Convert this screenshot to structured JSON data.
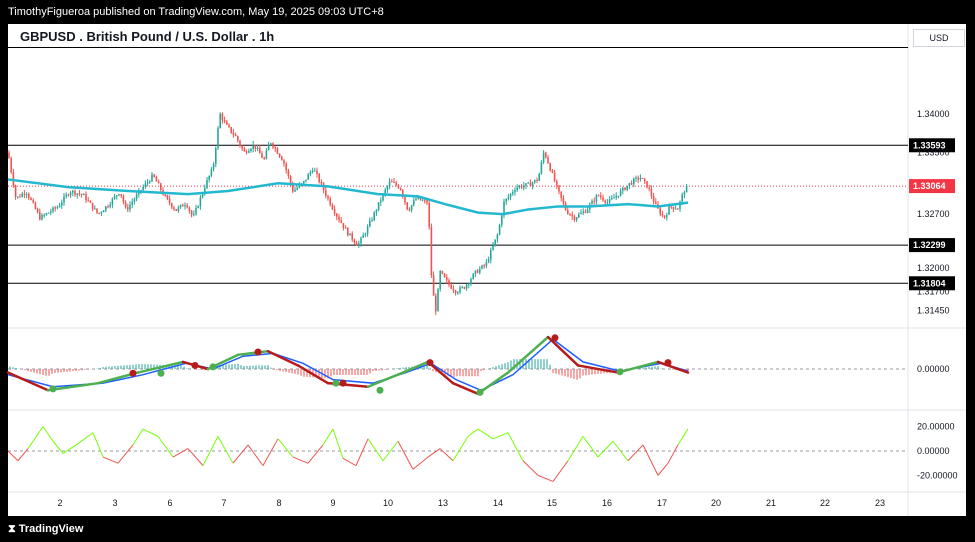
{
  "header": {
    "published_by": "TimothyFigueroa published on TradingView.com, May 19, 2025 09:03 UTC+8",
    "currency": "USD",
    "brand": "TradingView"
  },
  "colors": {
    "up": "#26a69a",
    "down": "#ef5350",
    "ema": "#22b8cf",
    "macd_fast": "#1e5eff",
    "macd_slow_up": "#4caf50",
    "macd_slow_down": "#b71c1c",
    "cci_up": "#76ff03",
    "cci_down": "#ef5350",
    "price_tag": "#f23645"
  },
  "chart_data": [
    {
      "type": "candlestick",
      "title": "GBPUSD . British Pound / U.S. Dollar . 1h",
      "ylim": [
        1.3125,
        1.3488
      ],
      "y_ticks": [
        1.3145,
        1.317,
        1.32,
        1.327,
        1.335,
        1.34
      ],
      "y_tick_labels": [
        "1.31450",
        "1.31700",
        "1.32000",
        "1.32700",
        "1.33500",
        "1.34000"
      ],
      "x_ticks": [
        "2",
        "3",
        "6",
        "7",
        "8",
        "9",
        "10",
        "13",
        "14",
        "15",
        "16",
        "17",
        "20",
        "21",
        "22",
        "23"
      ],
      "horizontal_levels": [
        {
          "value": 1.3486,
          "label": ""
        },
        {
          "value": 1.33593,
          "label": "1.33593"
        },
        {
          "value": 1.32299,
          "label": "1.32299"
        },
        {
          "value": 1.31804,
          "label": "1.31804"
        }
      ],
      "current_price": {
        "value": 1.33064,
        "label": "1.33064"
      },
      "price_path": [
        [
          0,
          1.335
        ],
        [
          8,
          1.329
        ],
        [
          18,
          1.33
        ],
        [
          32,
          1.3265
        ],
        [
          50,
          1.328
        ],
        [
          62,
          1.33
        ],
        [
          75,
          1.3295
        ],
        [
          90,
          1.327
        ],
        [
          100,
          1.3282
        ],
        [
          112,
          1.33
        ],
        [
          118,
          1.3275
        ],
        [
          132,
          1.33
        ],
        [
          145,
          1.332
        ],
        [
          158,
          1.329
        ],
        [
          168,
          1.3275
        ],
        [
          178,
          1.3285
        ],
        [
          185,
          1.3265
        ],
        [
          198,
          1.331
        ],
        [
          205,
          1.333
        ],
        [
          212,
          1.34
        ],
        [
          218,
          1.3385
        ],
        [
          228,
          1.337
        ],
        [
          236,
          1.335
        ],
        [
          246,
          1.336
        ],
        [
          256,
          1.334
        ],
        [
          262,
          1.3365
        ],
        [
          275,
          1.334
        ],
        [
          285,
          1.33
        ],
        [
          295,
          1.331
        ],
        [
          305,
          1.333
        ],
        [
          318,
          1.3295
        ],
        [
          328,
          1.327
        ],
        [
          340,
          1.3245
        ],
        [
          350,
          1.323
        ],
        [
          358,
          1.3248
        ],
        [
          366,
          1.327
        ],
        [
          375,
          1.3295
        ],
        [
          382,
          1.3312
        ],
        [
          392,
          1.3305
        ],
        [
          400,
          1.3275
        ],
        [
          408,
          1.329
        ],
        [
          420,
          1.3285
        ],
        [
          424,
          1.3175
        ],
        [
          428,
          1.3145
        ],
        [
          432,
          1.3195
        ],
        [
          440,
          1.318
        ],
        [
          448,
          1.317
        ],
        [
          456,
          1.3175
        ],
        [
          468,
          1.3195
        ],
        [
          478,
          1.3205
        ],
        [
          490,
          1.3245
        ],
        [
          496,
          1.3285
        ],
        [
          508,
          1.3305
        ],
        [
          520,
          1.3308
        ],
        [
          530,
          1.3315
        ],
        [
          536,
          1.3352
        ],
        [
          542,
          1.333
        ],
        [
          550,
          1.33
        ],
        [
          558,
          1.3275
        ],
        [
          566,
          1.3265
        ],
        [
          578,
          1.3275
        ],
        [
          590,
          1.3295
        ],
        [
          600,
          1.3285
        ],
        [
          612,
          1.3298
        ],
        [
          622,
          1.331
        ],
        [
          632,
          1.3318
        ],
        [
          640,
          1.3305
        ],
        [
          648,
          1.328
        ],
        [
          656,
          1.3265
        ],
        [
          662,
          1.328
        ],
        [
          670,
          1.3278
        ],
        [
          676,
          1.33
        ],
        [
          680,
          1.3306
        ]
      ],
      "ema_path": [
        [
          0,
          1.3315
        ],
        [
          60,
          1.3305
        ],
        [
          120,
          1.33
        ],
        [
          180,
          1.3296
        ],
        [
          220,
          1.33
        ],
        [
          270,
          1.331
        ],
        [
          320,
          1.3306
        ],
        [
          370,
          1.3296
        ],
        [
          410,
          1.3293
        ],
        [
          440,
          1.3282
        ],
        [
          470,
          1.3272
        ],
        [
          495,
          1.327
        ],
        [
          520,
          1.3276
        ],
        [
          550,
          1.328
        ],
        [
          580,
          1.328
        ],
        [
          620,
          1.3283
        ],
        [
          650,
          1.328
        ],
        [
          680,
          1.3285
        ]
      ]
    },
    {
      "type": "line",
      "ylim": [
        -0.00055,
        0.00055
      ],
      "y_ticks": [
        0
      ],
      "y_tick_labels": [
        "0.00000"
      ],
      "series": [
        {
          "values": [
            [
              0,
              -5e-05
            ],
            [
              40,
              -0.0003
            ],
            [
              90,
              -0.0002
            ],
            [
              130,
              -5e-05
            ],
            [
              175,
              0.0001
            ],
            [
              200,
              0.0
            ],
            [
              230,
              0.0002
            ],
            [
              260,
              0.00025
            ],
            [
              290,
              5e-05
            ],
            [
              320,
              -0.0002
            ],
            [
              360,
              -0.00025
            ],
            [
              395,
              -5e-05
            ],
            [
              420,
              0.0001
            ],
            [
              445,
              -0.0002
            ],
            [
              470,
              -0.00035
            ],
            [
              500,
              -5e-05
            ],
            [
              540,
              0.00045
            ],
            [
              570,
              5e-05
            ],
            [
              610,
              -5e-05
            ],
            [
              650,
              0.0001
            ],
            [
              680,
              -5e-05
            ]
          ]
        },
        {
          "values": [
            [
              0,
              -8e-05
            ],
            [
              45,
              -0.00025
            ],
            [
              95,
              -0.0002
            ],
            [
              135,
              -8e-05
            ],
            [
              178,
              8e-05
            ],
            [
              205,
              0.0
            ],
            [
              235,
              0.00018
            ],
            [
              265,
              0.00022
            ],
            [
              295,
              8e-05
            ],
            [
              325,
              -0.00015
            ],
            [
              365,
              -0.0002
            ],
            [
              398,
              -5e-05
            ],
            [
              423,
              8e-05
            ],
            [
              448,
              -0.00015
            ],
            [
              473,
              -0.0003
            ],
            [
              505,
              -8e-05
            ],
            [
              545,
              0.00042
            ],
            [
              575,
              0.0001
            ],
            [
              612,
              -3e-05
            ],
            [
              653,
              8e-05
            ],
            [
              680,
              -3e-05
            ]
          ]
        }
      ],
      "histogram": [
        [
          20,
          -5e-05
        ],
        [
          60,
          -4e-05
        ],
        [
          100,
          3e-05
        ],
        [
          140,
          3e-05
        ],
        [
          180,
          4e-05
        ],
        [
          220,
          5e-05
        ],
        [
          260,
          -3e-05
        ],
        [
          300,
          -4e-05
        ],
        [
          340,
          -2e-05
        ],
        [
          380,
          3e-05
        ],
        [
          420,
          4e-05
        ],
        [
          460,
          -3e-05
        ],
        [
          500,
          5e-05
        ],
        [
          540,
          2e-05
        ],
        [
          580,
          -4e-05
        ],
        [
          620,
          2e-05
        ],
        [
          660,
          -2e-05
        ]
      ]
    },
    {
      "type": "line",
      "ylim": [
        -32,
        32
      ],
      "y_ticks": [
        20,
        0,
        -20
      ],
      "y_tick_labels": [
        "20.00000",
        "0.00000",
        "-20.00000"
      ],
      "series": [
        {
          "values": [
            [
              0,
              0
            ],
            [
              10,
              -8
            ],
            [
              20,
              2
            ],
            [
              35,
              20
            ],
            [
              45,
              8
            ],
            [
              55,
              -2
            ],
            [
              70,
              6
            ],
            [
              85,
              15
            ],
            [
              95,
              -5
            ],
            [
              110,
              -10
            ],
            [
              125,
              5
            ],
            [
              135,
              18
            ],
            [
              150,
              12
            ],
            [
              165,
              -5
            ],
            [
              180,
              2
            ],
            [
              195,
              -12
            ],
            [
              210,
              12
            ],
            [
              225,
              -10
            ],
            [
              240,
              5
            ],
            [
              255,
              -12
            ],
            [
              270,
              10
            ],
            [
              285,
              -5
            ],
            [
              300,
              -10
            ],
            [
              315,
              5
            ],
            [
              325,
              18
            ],
            [
              335,
              -6
            ],
            [
              348,
              -12
            ],
            [
              360,
              10
            ],
            [
              375,
              -8
            ],
            [
              390,
              8
            ],
            [
              405,
              -15
            ],
            [
              420,
              -5
            ],
            [
              432,
              2
            ],
            [
              445,
              -8
            ],
            [
              460,
              12
            ],
            [
              470,
              18
            ],
            [
              485,
              10
            ],
            [
              500,
              15
            ],
            [
              515,
              -8
            ],
            [
              530,
              -20
            ],
            [
              545,
              -25
            ],
            [
              560,
              -8
            ],
            [
              575,
              12
            ],
            [
              590,
              -5
            ],
            [
              605,
              8
            ],
            [
              620,
              -8
            ],
            [
              635,
              5
            ],
            [
              650,
              -20
            ],
            [
              660,
              -10
            ],
            [
              670,
              5
            ],
            [
              680,
              18
            ]
          ]
        }
      ]
    }
  ]
}
